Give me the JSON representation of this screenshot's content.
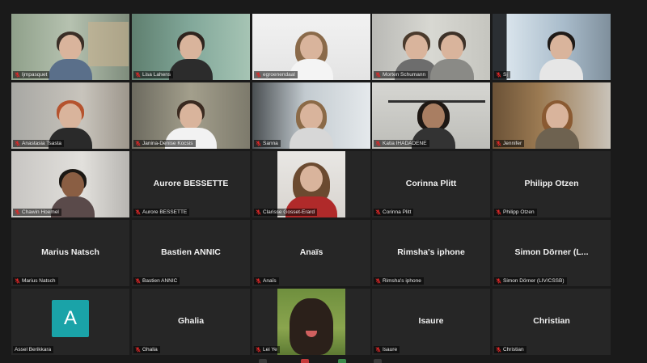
{
  "meeting": {
    "participants": [
      {
        "id": "p1",
        "display_name": "",
        "label": "ljmpasquet",
        "muted": true,
        "video": true
      },
      {
        "id": "p2",
        "display_name": "",
        "label": "Lisa Lahens",
        "muted": true,
        "video": true
      },
      {
        "id": "p3",
        "display_name": "",
        "label": "egroenendaal",
        "muted": true,
        "video": true
      },
      {
        "id": "p4",
        "display_name": "",
        "label": "Morten Schumann",
        "muted": true,
        "video": true
      },
      {
        "id": "p5",
        "display_name": "",
        "label": "Sj",
        "muted": true,
        "video": true
      },
      {
        "id": "p6",
        "display_name": "",
        "label": "Anastasia Tsasta",
        "muted": true,
        "video": true
      },
      {
        "id": "p7",
        "display_name": "",
        "label": "Janina-Denise Kocsis",
        "muted": true,
        "video": true
      },
      {
        "id": "p8",
        "display_name": "",
        "label": "Sanna",
        "muted": true,
        "video": true
      },
      {
        "id": "p9",
        "display_name": "",
        "label": "Katia IHADADENE",
        "muted": true,
        "video": true
      },
      {
        "id": "p10",
        "display_name": "",
        "label": "Jennifer",
        "muted": true,
        "video": true
      },
      {
        "id": "p11",
        "display_name": "",
        "label": "Chawin Hoemel",
        "muted": true,
        "video": true
      },
      {
        "id": "p12",
        "display_name": "Aurore BESSETTE",
        "label": "Aurore BESSETTE",
        "muted": true,
        "video": false
      },
      {
        "id": "p13",
        "display_name": "",
        "label": "Clarisse Gosset-Erard",
        "muted": true,
        "video": true
      },
      {
        "id": "p14",
        "display_name": "Corinna Plitt",
        "label": "Corinna Plitt",
        "muted": true,
        "video": false
      },
      {
        "id": "p15",
        "display_name": "Philipp Otzen",
        "label": "Philipp Otzen",
        "muted": true,
        "video": false
      },
      {
        "id": "p16",
        "display_name": "Marius Natsch",
        "label": "Marius Natsch",
        "muted": true,
        "video": false
      },
      {
        "id": "p17",
        "display_name": "Bastien ANNIC",
        "label": "Bastien ANNIC",
        "muted": true,
        "video": false
      },
      {
        "id": "p18",
        "display_name": "Anaïs",
        "label": "Anaïs",
        "muted": true,
        "video": false
      },
      {
        "id": "p19",
        "display_name": "Rimsha's iphone",
        "label": "Rimsha's iphone",
        "muted": true,
        "video": false
      },
      {
        "id": "p20",
        "display_name": "Simon Dörner (L...",
        "label": "Simon Dörner (LIV/CSSB)",
        "muted": true,
        "video": false
      },
      {
        "id": "p21",
        "display_name": "",
        "avatar_letter": "A",
        "label": "Assel Berikkara",
        "muted": false,
        "video": false
      },
      {
        "id": "p22",
        "display_name": "Ghalia",
        "label": "Ghalia",
        "muted": true,
        "video": false
      },
      {
        "id": "p23",
        "display_name": "",
        "label": "Lei Ye",
        "muted": true,
        "video": true
      },
      {
        "id": "p24",
        "display_name": "Isaure",
        "label": "Isaure",
        "muted": true,
        "video": false
      },
      {
        "id": "p25",
        "display_name": "Christian",
        "label": "Christian",
        "muted": true,
        "video": false
      }
    ]
  },
  "colors": {
    "background": "#1a1a1a",
    "tile": "#262626",
    "muted_icon": "#e02828",
    "avatar": "#1aa3a8"
  }
}
